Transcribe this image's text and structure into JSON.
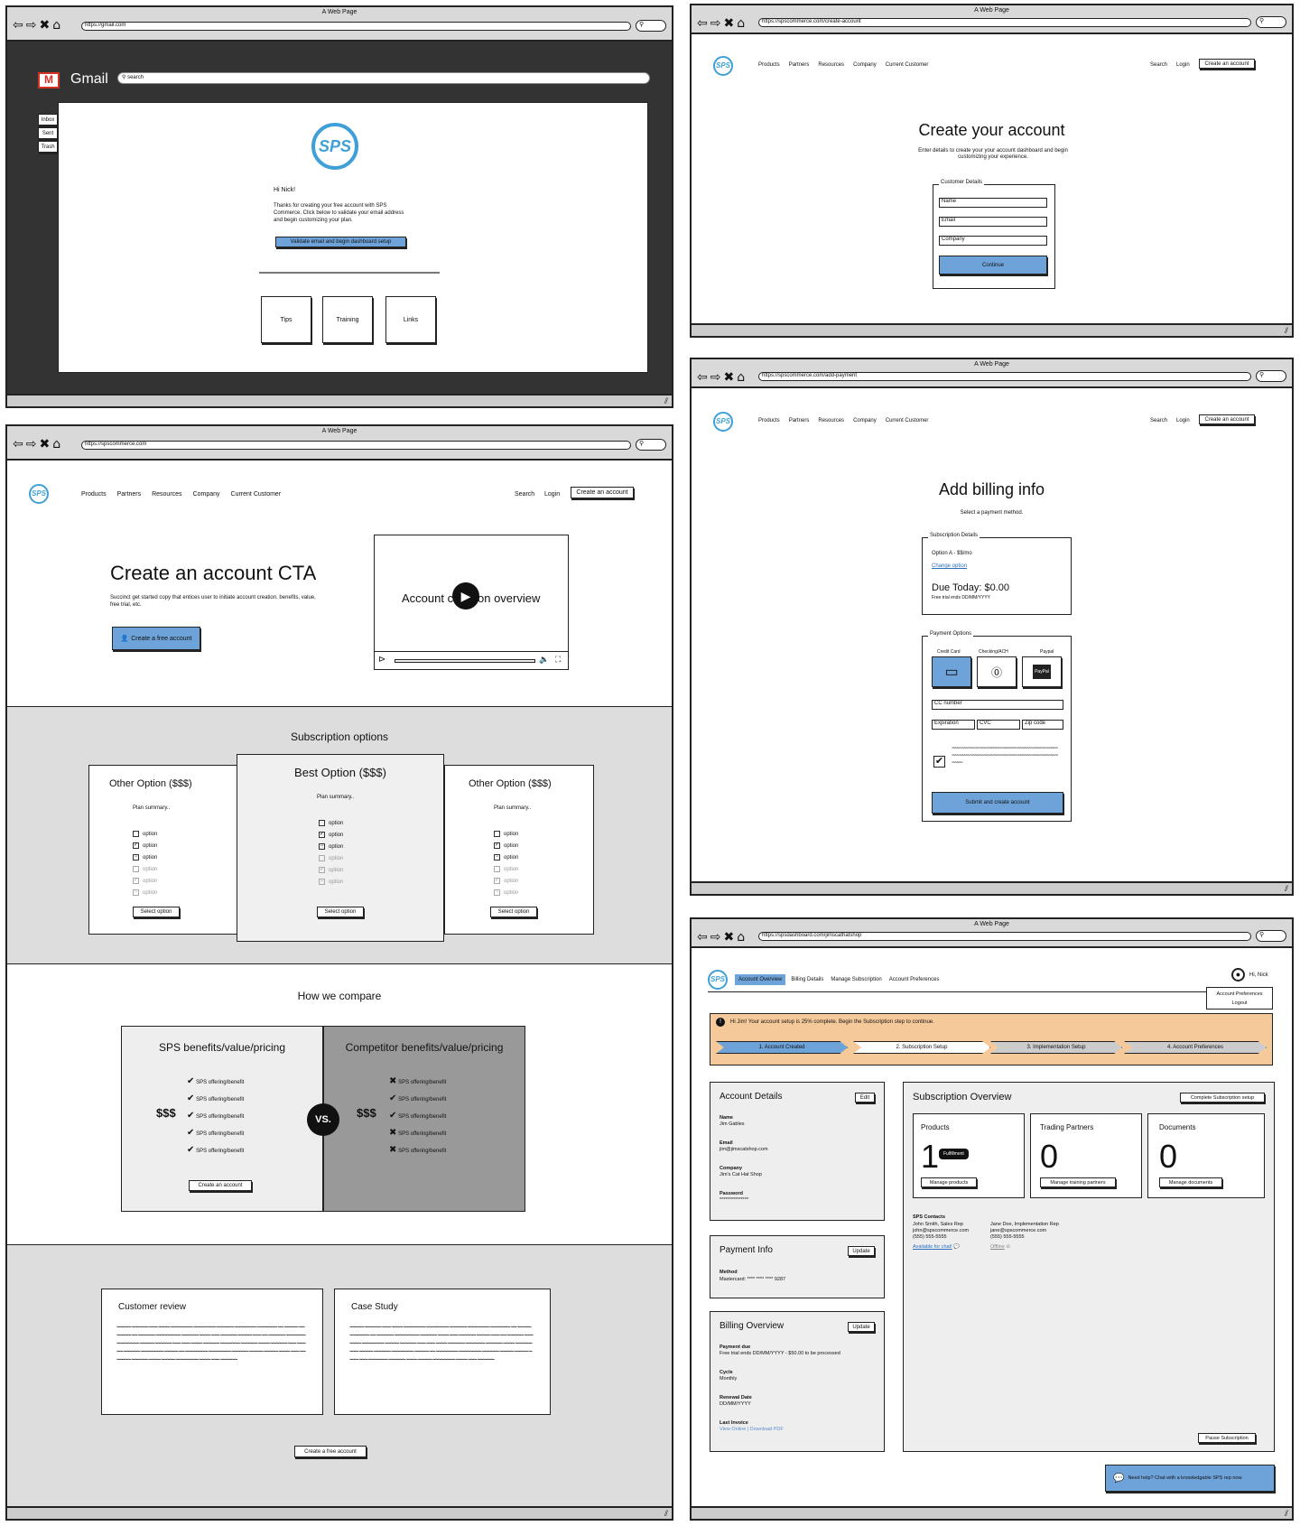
{
  "window_title": "A Web Page",
  "gmail": {
    "url": "https://gmail.com",
    "brand": "Gmail",
    "search_placeholder": "search",
    "folders": [
      "Inbox",
      "Sent",
      "Trash"
    ],
    "greeting": "Hi Nick!",
    "body": "Thanks for creating your free account with SPS Commerce. Click below to validate your email address and begin customizing your plan.",
    "cta": "Validate email and begin dashboard setup",
    "cards": [
      "Tips",
      "Training",
      "Links"
    ]
  },
  "landing": {
    "url": "https://spscommerce.com",
    "nav": [
      "Products",
      "Partners",
      "Resources",
      "Company",
      "Current Customer"
    ],
    "search": "Search",
    "login": "Login",
    "create": "Create an account",
    "hero_title": "Create an account CTA",
    "hero_copy": "Succinct get started copy that entices user to initiate account creation, benefits, value, free trial, etc.",
    "hero_cta": "Create a free account",
    "video_title": "Account creation overview",
    "video_a": "Account c",
    "video_b": "on overview",
    "subs_title": "Subscription options",
    "plans": [
      {
        "title": "Other Option ($$$)",
        "summary": "Plan summary..",
        "select": "Select option"
      },
      {
        "title": "Best Option ($$$)",
        "summary": "Plan summary..",
        "select": "Select option"
      },
      {
        "title": "Other Option ($$$)",
        "summary": "Plan summary..",
        "select": "Select option"
      }
    ],
    "option": "option",
    "compare_title": "How we compare",
    "sps_title": "SPS benefits/value/pricing",
    "comp_title": "Competitor benefits/value/pricing",
    "benefit": "SPS offering/benefit",
    "price": "$$$",
    "vs": "VS.",
    "compare_cta": "Create an account",
    "review_title": "Customer review",
    "case_title": "Case Study",
    "bottom_cta": "Create a free account"
  },
  "create": {
    "url": "https://spscommerce.com/create-account",
    "title": "Create your account",
    "subtitle": "Enter details to create your your account dashboard and begin customizing your experience.",
    "legend": "Customer Details",
    "fields": [
      "Name",
      "Email",
      "Company"
    ],
    "cta": "Continue"
  },
  "billing": {
    "url": "https://spscommerce.com/add-payment",
    "title": "Add billing info",
    "subtitle": "Select a payment method.",
    "sub_legend": "Subscription Details",
    "option": "Option A - $$/mo",
    "change": "Change option",
    "due": "Due Today: $0.00",
    "trial": "Free trial ends DD/MM/YYYY",
    "pay_legend": "Payment Options",
    "methods": [
      "Credit Card",
      "Checking/ACH",
      "Paypal"
    ],
    "paypal": "PayPal",
    "cc": "CC number",
    "exp": "Expiration",
    "cvc": "CVC",
    "zip": "Zip code",
    "cta": "Submit and create account"
  },
  "dash": {
    "url": "https://spsdashboard.com/jimscathatshop",
    "tabs": [
      "Account Overview",
      "Billing Details",
      "Manage Subscription",
      "Account Preferences"
    ],
    "user": "Hi, Nick",
    "menu": [
      "Account Preferences",
      "Logout"
    ],
    "alert": "Hi Jim! Your account setup is 25% complete. Begin the Subscription step to continue.",
    "steps": [
      "1. Account Created",
      "2. Subscription Setup",
      "3. Implementation Setup",
      "4. Account Preferences"
    ],
    "acct_title": "Account Details",
    "edit": "Edit",
    "acct": [
      [
        "Name",
        "Jim Gables"
      ],
      [
        "Email",
        "jim@jimscatshop.com"
      ],
      [
        "Company",
        "Jim's Cat Hat Shop"
      ],
      [
        "Password",
        "***************"
      ]
    ],
    "pay_title": "Payment Info",
    "update": "Update",
    "method_label": "Method",
    "method": "Mastercard: **** **** **** 9287",
    "bill_title": "Billing Overview",
    "bill": [
      [
        "Payment due",
        "Free trial ends DD/MM/YYYY - $50.00 to be processed"
      ],
      [
        "Cycle",
        "Monthly"
      ],
      [
        "Renewal Date",
        "DD/MM/YYYY"
      ],
      [
        "Last Invoice",
        "View Online | Download PDF"
      ]
    ],
    "sub_title": "Subscription Overview",
    "sub_cta": "Complete Subscription setup",
    "tiles": [
      {
        "label": "Products",
        "value": "1",
        "badge": "Fulfillment",
        "btn": "Manage products"
      },
      {
        "label": "Trading Partners",
        "value": "0",
        "btn": "Manage training partners"
      },
      {
        "label": "Documents",
        "value": "0",
        "btn": "Manage documents"
      }
    ],
    "contacts_title": "SPS Contacts",
    "contacts": [
      {
        "name": "John Smith, Sales Rep",
        "email": "john@spscommerce.com",
        "phone": "(555) 555-5555",
        "status": "Available for chat!"
      },
      {
        "name": "Jane Doe, Implementation Rep",
        "email": "jane@spscommerce.com",
        "phone": "(555) 555-5555",
        "status": "Offline"
      }
    ],
    "pause": "Pause Subscription",
    "help": "Need help? Chat with a knowledgable SPS rep now."
  },
  "colors": {
    "accent": "#6ea3d9",
    "alert": "#f6c99b",
    "logo": "#3fa0d8"
  }
}
